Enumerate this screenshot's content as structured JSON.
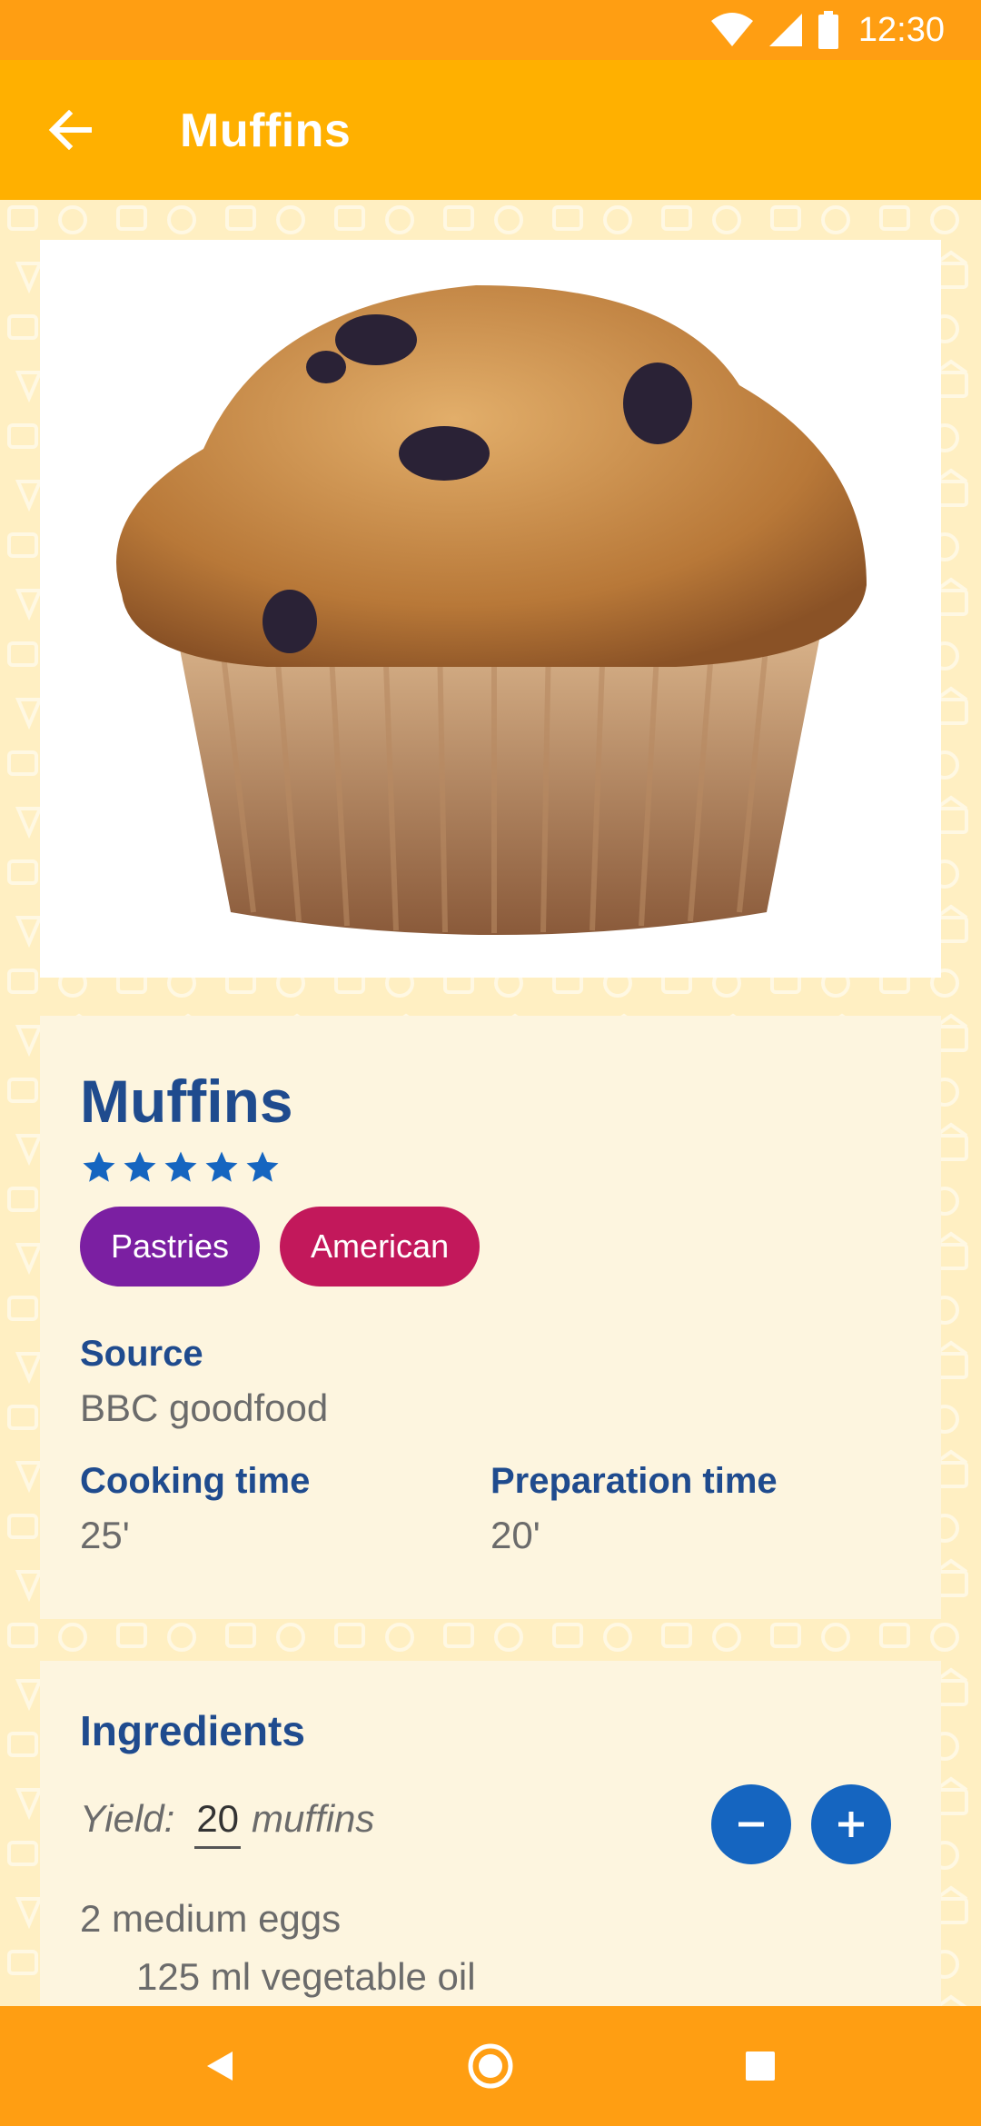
{
  "status_bar": {
    "time": "12:30"
  },
  "app_bar": {
    "title": "Muffins"
  },
  "recipe": {
    "title": "Muffins",
    "rating": 5,
    "rating_max": 5,
    "tags": [
      {
        "label": "Pastries",
        "color": "#7B1FA2"
      },
      {
        "label": "American",
        "color": "#C2185B"
      }
    ],
    "source_label": "Source",
    "source_value": "BBC goodfood",
    "cooking_label": "Cooking time",
    "cooking_value": "25'",
    "prep_label": "Preparation time",
    "prep_value": "20'"
  },
  "ingredients": {
    "title": "Ingredients",
    "yield_label": "Yield:",
    "yield_value": "20",
    "yield_unit": "muffins",
    "items": [
      "2 medium eggs",
      "125 ml vegetable oil"
    ]
  },
  "colors": {
    "accent": "#1565C0",
    "app_bar": "#FFB000",
    "status_bar": "#FF9E12",
    "title_text": "#1F4B8E"
  },
  "icons": {
    "back": "arrow-left-icon",
    "decrease": "minus-icon",
    "increase": "plus-icon",
    "nav_back": "triangle-back-icon",
    "nav_home": "circle-home-icon",
    "nav_recents": "square-recents-icon"
  }
}
